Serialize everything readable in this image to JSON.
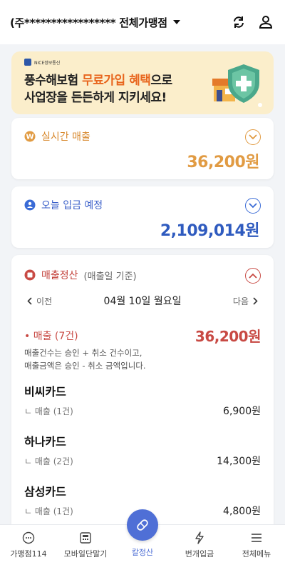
{
  "header": {
    "store_name": "(주***************** 전체가맹점"
  },
  "banner": {
    "brand": "NICE정보통신",
    "line1_prefix": "풍수해보험 ",
    "line1_highlight": "무료가입 혜택",
    "line1_suffix": "으로",
    "line2": "사업장을 든든하게 지키세요!"
  },
  "realtime": {
    "title": "실시간 매출",
    "amount": "36,200원",
    "color": "#e19b43"
  },
  "deposit": {
    "title": "오늘 입금 예정",
    "amount": "2,109,014원",
    "color": "#2f5bbf"
  },
  "settlement": {
    "title": "매출정산",
    "subtitle": "(매출일 기준)",
    "prev": "이전",
    "date": "04월 10일 월요일",
    "next": "다음",
    "sales_label": "• 매출 (7건)",
    "sales_amount": "36,200원",
    "note_line1": "매출건수는 승인 + 취소 건수이고,",
    "note_line2": "매출금액은 승인 - 취소 금액입니다.",
    "cards": [
      {
        "name": "비씨카드",
        "label": "ㄴ 매출 (1건)",
        "amount": "6,900원"
      },
      {
        "name": "하나카드",
        "label": "ㄴ 매출 (2건)",
        "amount": "14,300원"
      },
      {
        "name": "삼성카드",
        "label": "ㄴ 매출 (1건)",
        "amount": "4,800원"
      }
    ],
    "color": "#c84a44"
  },
  "bottom_nav": {
    "items": [
      {
        "label": "가맹점114",
        "icon": "chat-icon"
      },
      {
        "label": "모바일단말기",
        "icon": "terminal-icon"
      },
      {
        "label": "칼정산",
        "icon": "pill-icon"
      },
      {
        "label": "번개입금",
        "icon": "lightning-icon"
      },
      {
        "label": "전체메뉴",
        "icon": "menu-icon"
      }
    ],
    "accent": "#4f6fd6"
  }
}
